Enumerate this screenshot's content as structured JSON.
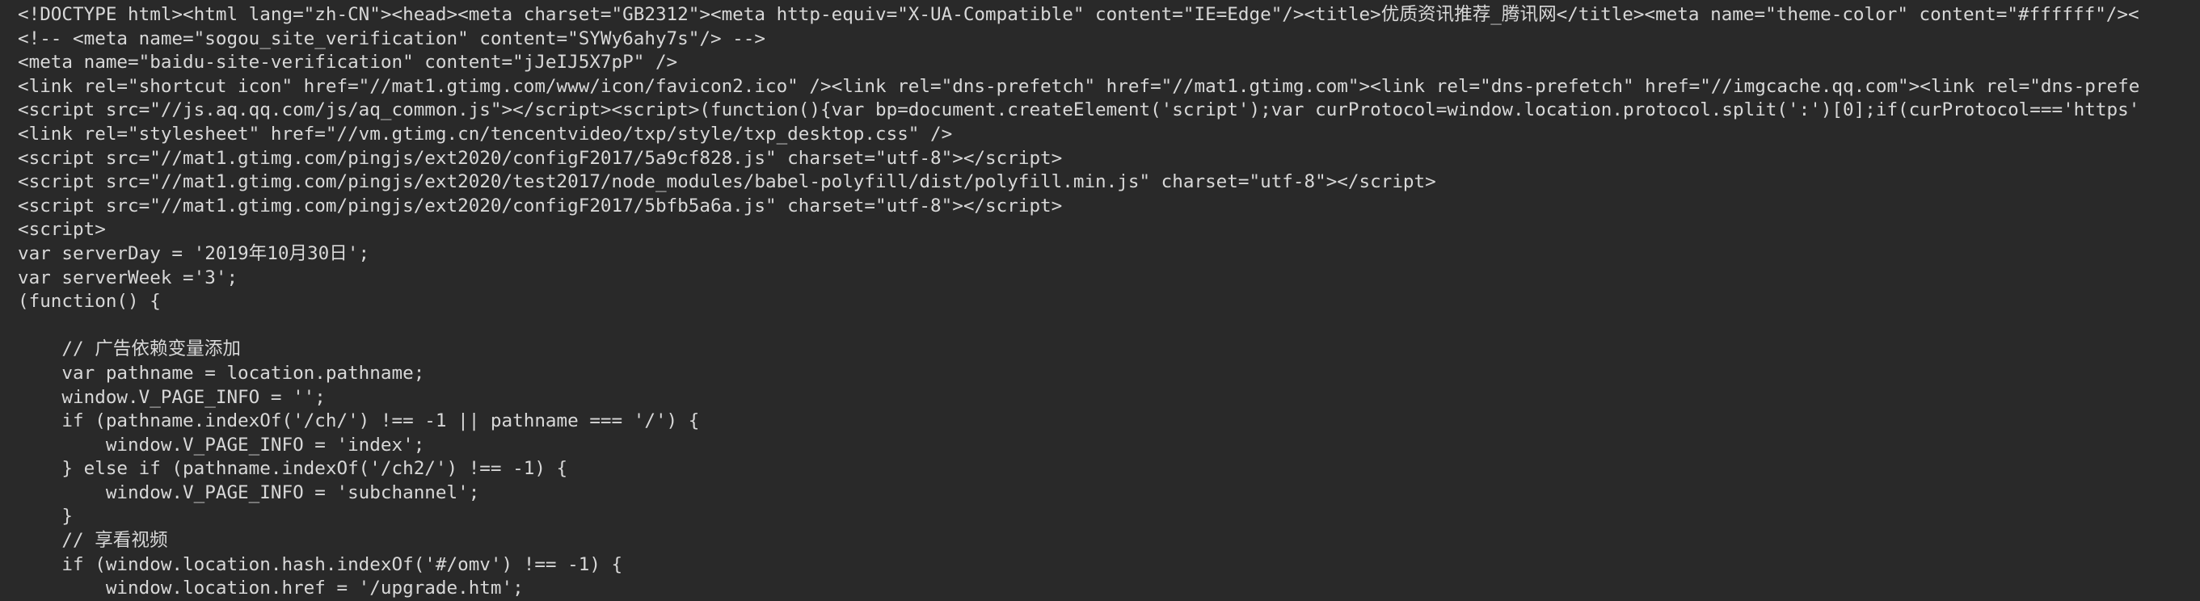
{
  "source_lines": [
    "<!DOCTYPE html><html lang=\"zh-CN\"><head><meta charset=\"GB2312\"><meta http-equiv=\"X-UA-Compatible\" content=\"IE=Edge\"/><title>优质资讯推荐_腾讯网</title><meta name=\"theme-color\" content=\"#ffffff\"/><",
    "<!-- <meta name=\"sogou_site_verification\" content=\"SYWy6ahy7s\"/> -->",
    "<meta name=\"baidu-site-verification\" content=\"jJeIJ5X7pP\" />",
    "<link rel=\"shortcut icon\" href=\"//mat1.gtimg.com/www/icon/favicon2.ico\" /><link rel=\"dns-prefetch\" href=\"//mat1.gtimg.com\"><link rel=\"dns-prefetch\" href=\"//imgcache.qq.com\"><link rel=\"dns-prefe",
    "<script src=\"//js.aq.qq.com/js/aq_common.js\"></script><script>(function(){var bp=document.createElement('script');var curProtocol=window.location.protocol.split(':')[0];if(curProtocol==='https'",
    "<link rel=\"stylesheet\" href=\"//vm.gtimg.cn/tencentvideo/txp/style/txp_desktop.css\" />",
    "<script src=\"//mat1.gtimg.com/pingjs/ext2020/configF2017/5a9cf828.js\" charset=\"utf-8\"></script>",
    "<script src=\"//mat1.gtimg.com/pingjs/ext2020/test2017/node_modules/babel-polyfill/dist/polyfill.min.js\" charset=\"utf-8\"></script>",
    "<script src=\"//mat1.gtimg.com/pingjs/ext2020/configF2017/5bfb5a6a.js\" charset=\"utf-8\"></script>",
    "<script>",
    "var serverDay = '2019年10月30日';",
    "var serverWeek ='3';",
    "(function() {",
    "",
    "    // 广告依赖变量添加",
    "    var pathname = location.pathname;",
    "    window.V_PAGE_INFO = '';",
    "    if (pathname.indexOf('/ch/') !== -1 || pathname === '/') {",
    "        window.V_PAGE_INFO = 'index';",
    "    } else if (pathname.indexOf('/ch2/') !== -1) {",
    "        window.V_PAGE_INFO = 'subchannel';",
    "    }",
    "    // 享看视频",
    "    if (window.location.hash.indexOf('#/omv') !== -1) {",
    "        window.location.href = '/upgrade.htm';"
  ]
}
